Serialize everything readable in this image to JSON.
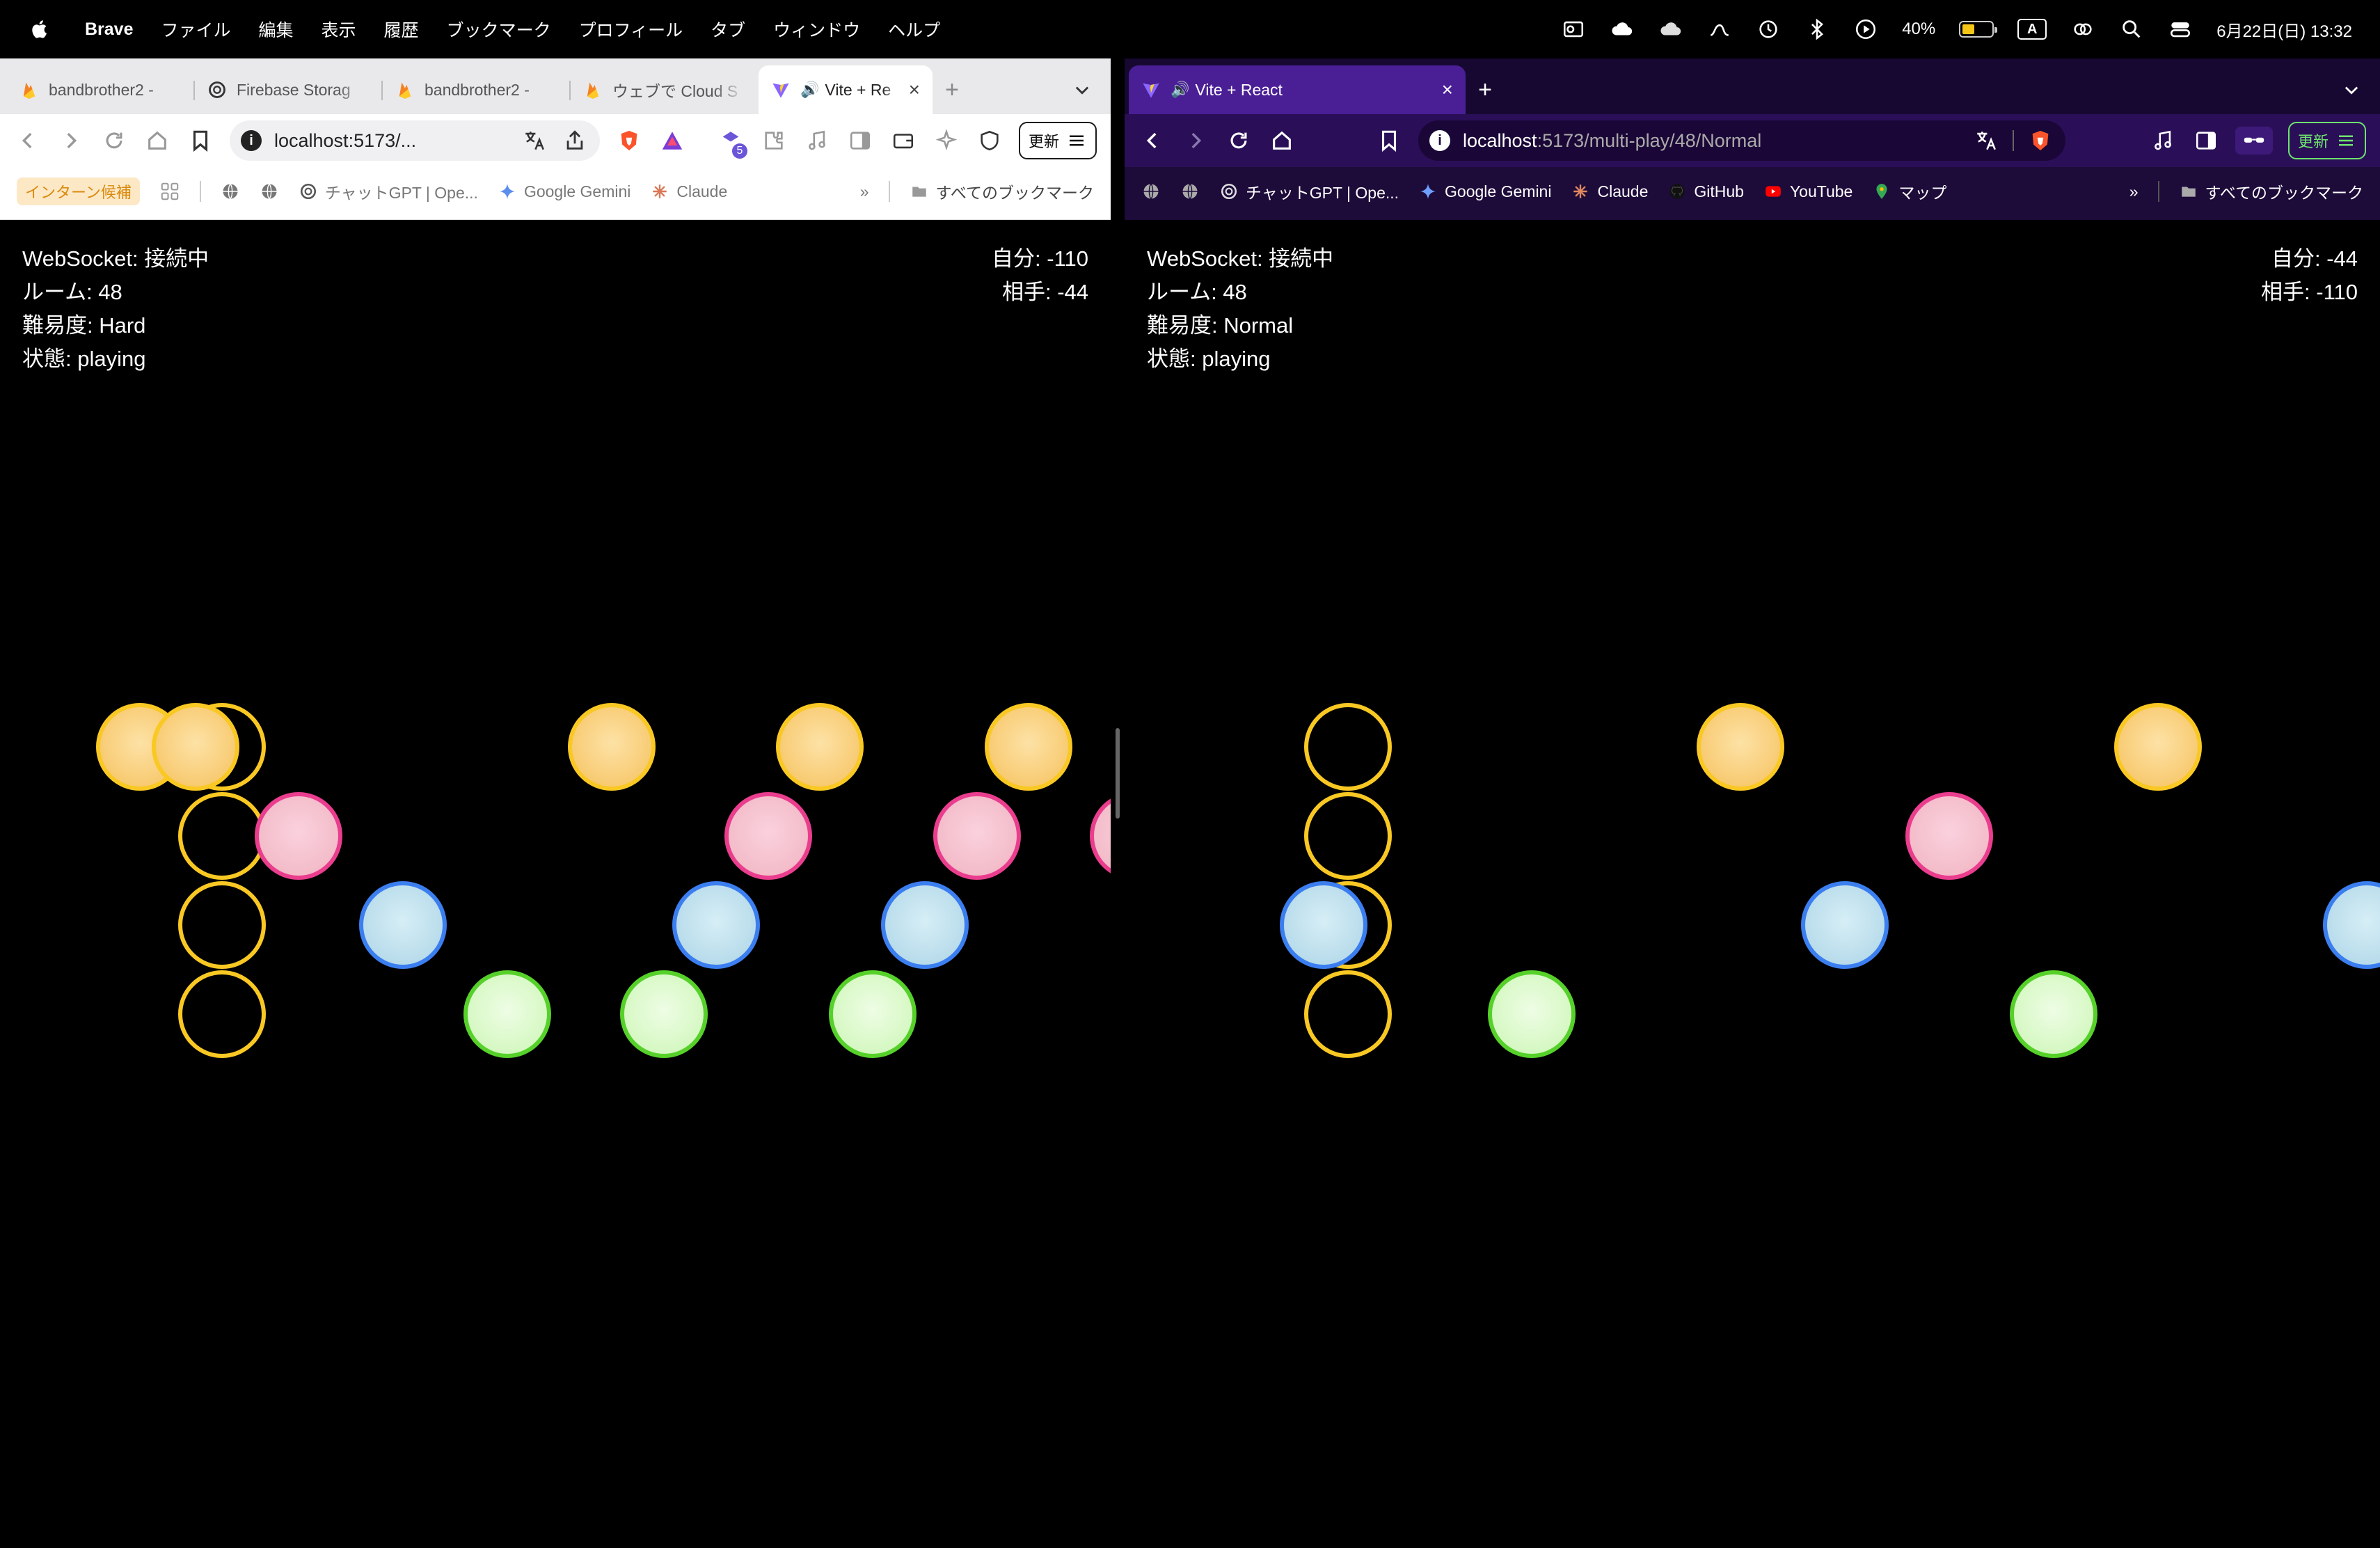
{
  "menubar": {
    "app": "Brave",
    "items": [
      "ファイル",
      "編集",
      "表示",
      "履歴",
      "ブックマーク",
      "プロフィール",
      "タブ",
      "ウィンドウ",
      "ヘルプ"
    ],
    "battery": "40%",
    "input_mode": "A",
    "datetime": "6月22日(日) 13:32"
  },
  "left_window": {
    "tabs": [
      {
        "label": "bandbrother2 -",
        "icon": "firebase-icon"
      },
      {
        "label": "Firebase Storag",
        "icon": "openai-icon"
      },
      {
        "label": "bandbrother2 -",
        "icon": "firebase-icon"
      },
      {
        "label": "ウェブで Cloud S",
        "icon": "firebase-icon"
      },
      {
        "label": "Vite + Re",
        "icon": "vite-icon",
        "active": true
      }
    ],
    "url": "localhost:5173/...",
    "update_label": "更新",
    "extension_badge": "5",
    "bookmarks": [
      {
        "label": "インターン候補",
        "type": "pill"
      },
      {
        "label": "",
        "icon": "apps-grid-icon"
      },
      {
        "label": "",
        "icon": "globe-icon"
      },
      {
        "label": "",
        "icon": "globe-icon"
      },
      {
        "label": "チャットGPT | Ope...",
        "icon": "openai-icon"
      },
      {
        "label": "Google Gemini",
        "icon": "gemini-icon"
      },
      {
        "label": "Claude",
        "icon": "claude-icon"
      }
    ],
    "all_bookmarks": "すべてのブックマーク",
    "game": {
      "websocket": "WebSocket: 接続中",
      "room": "ルーム: 48",
      "difficulty": "難易度: Hard",
      "state": "状態: playing",
      "self_score": "自分: -110",
      "opponent_score": "相手: -44"
    }
  },
  "right_window": {
    "tabs": [
      {
        "label": "Vite + React",
        "icon": "vite-icon",
        "active": true
      }
    ],
    "url_host": "localhost",
    "url_path": ":5173/multi-play/48/Normal",
    "update_label": "更新",
    "bookmarks": [
      {
        "label": "",
        "icon": "globe-icon"
      },
      {
        "label": "",
        "icon": "globe-icon"
      },
      {
        "label": "チャットGPT | Ope...",
        "icon": "openai-icon"
      },
      {
        "label": "Google Gemini",
        "icon": "gemini-icon"
      },
      {
        "label": "Claude",
        "icon": "claude-icon"
      },
      {
        "label": "GitHub",
        "icon": "github-icon"
      },
      {
        "label": "YouTube",
        "icon": "youtube-icon"
      },
      {
        "label": "マップ",
        "icon": "maps-icon"
      }
    ],
    "all_bookmarks": "すべてのブックマーク",
    "game": {
      "websocket": "WebSocket: 接続中",
      "room": "ルーム: 48",
      "difficulty": "難易度: Normal",
      "state": "状態: playing",
      "self_score": "自分: -44",
      "opponent_score": "相手: -110"
    }
  },
  "colors": {
    "lane_yellow": "#f9c823",
    "lane_pink": "#ea3d8e",
    "lane_blue": "#3b7ef0",
    "lane_green": "#56d12a",
    "dark_chrome": "#2a0f58"
  }
}
